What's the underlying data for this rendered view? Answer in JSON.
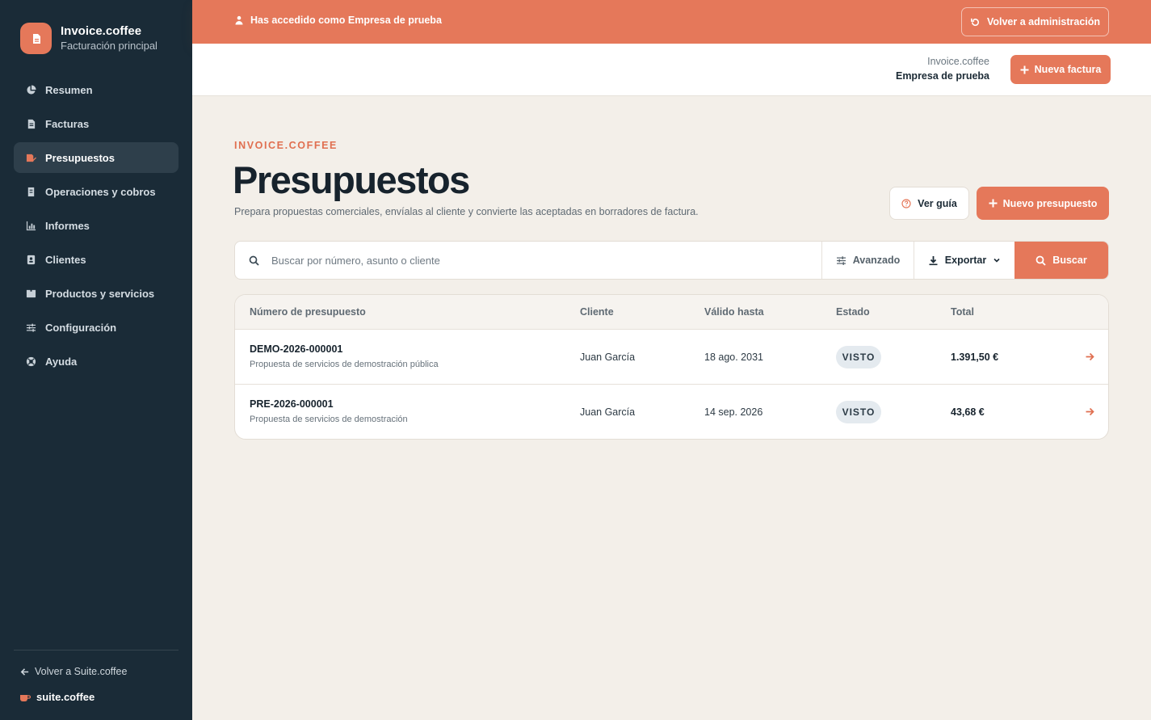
{
  "colors": {
    "accent": "#e5785a",
    "sidebar": "#1a2b37",
    "background": "#f3efe9"
  },
  "sidebar": {
    "brand_title": "Invoice.coffee",
    "brand_subtitle": "Facturación principal",
    "items": [
      {
        "label": "Resumen",
        "icon": "pie-chart-icon",
        "active": false
      },
      {
        "label": "Facturas",
        "icon": "document-icon",
        "active": false
      },
      {
        "label": "Presupuestos",
        "icon": "edit-document-icon",
        "active": true
      },
      {
        "label": "Operaciones y cobros",
        "icon": "receipt-icon",
        "active": false
      },
      {
        "label": "Informes",
        "icon": "bar-chart-icon",
        "active": false
      },
      {
        "label": "Clientes",
        "icon": "contact-icon",
        "active": false
      },
      {
        "label": "Productos y servicios",
        "icon": "box-icon",
        "active": false
      },
      {
        "label": "Configuración",
        "icon": "sliders-icon",
        "active": false
      },
      {
        "label": "Ayuda",
        "icon": "lifebuoy-icon",
        "active": false
      }
    ],
    "back_suite": "Volver a Suite.coffee",
    "suite_brand": "suite.coffee"
  },
  "banner": {
    "message": "Has accedido como Empresa de prueba",
    "back_admin": "Volver a administración"
  },
  "header": {
    "app": "Invoice.coffee",
    "company": "Empresa de prueba",
    "new_invoice": "Nueva factura"
  },
  "main": {
    "eyebrow": "INVOICE.COFFEE",
    "title": "Presupuestos",
    "description": "Prepara propuestas comerciales, envíalas al cliente y convierte las aceptadas en borradores de factura.",
    "guide_button": "Ver guía",
    "new_button": "Nuevo presupuesto"
  },
  "search": {
    "placeholder": "Buscar por número, asunto o cliente",
    "advanced": "Avanzado",
    "export": "Exportar",
    "submit": "Buscar"
  },
  "table": {
    "columns": [
      "Número de presupuesto",
      "Cliente",
      "Válido hasta",
      "Estado",
      "Total"
    ],
    "rows": [
      {
        "number": "DEMO-2026-000001",
        "subject": "Propuesta de servicios de demostración pública",
        "client": "Juan García",
        "valid_until": "18 ago. 2031",
        "status": "VISTO",
        "total": "1.391,50 €"
      },
      {
        "number": "PRE-2026-000001",
        "subject": "Propuesta de servicios de demostración",
        "client": "Juan García",
        "valid_until": "14 sep. 2026",
        "status": "VISTO",
        "total": "43,68 €"
      }
    ]
  }
}
